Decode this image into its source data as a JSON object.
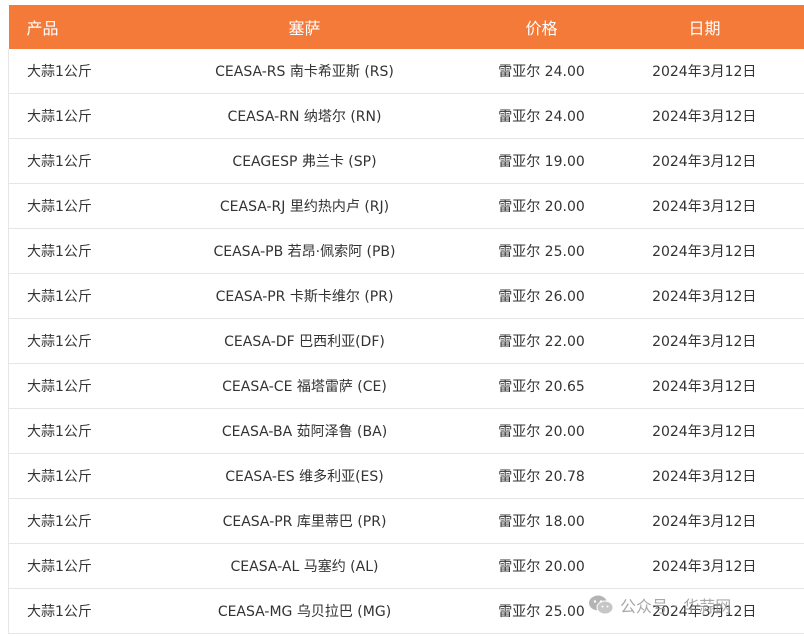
{
  "table": {
    "headers": [
      "产品",
      "塞萨",
      "价格",
      "日期"
    ],
    "rows": [
      {
        "product": "大蒜1公斤",
        "ceasa": "CEASA-RS 南卡希亚斯 (RS)",
        "price": "雷亚尔 24.00",
        "date": "2024年3月12日"
      },
      {
        "product": "大蒜1公斤",
        "ceasa": "CEASA-RN 纳塔尔 (RN)",
        "price": "雷亚尔 24.00",
        "date": "2024年3月12日"
      },
      {
        "product": "大蒜1公斤",
        "ceasa": "CEAGESP 弗兰卡 (SP)",
        "price": "雷亚尔 19.00",
        "date": "2024年3月12日"
      },
      {
        "product": "大蒜1公斤",
        "ceasa": "CEASA-RJ 里约热内卢 (RJ)",
        "price": "雷亚尔 20.00",
        "date": "2024年3月12日"
      },
      {
        "product": "大蒜1公斤",
        "ceasa": "CEASA-PB 若昂·佩索阿 (PB)",
        "price": "雷亚尔 25.00",
        "date": "2024年3月12日"
      },
      {
        "product": "大蒜1公斤",
        "ceasa": "CEASA-PR 卡斯卡维尔 (PR)",
        "price": "雷亚尔 26.00",
        "date": "2024年3月12日"
      },
      {
        "product": "大蒜1公斤",
        "ceasa": "CEASA-DF 巴西利亚(DF)",
        "price": "雷亚尔 22.00",
        "date": "2024年3月12日"
      },
      {
        "product": "大蒜1公斤",
        "ceasa": "CEASA-CE 福塔雷萨 (CE)",
        "price": "雷亚尔 20.65",
        "date": "2024年3月12日"
      },
      {
        "product": "大蒜1公斤",
        "ceasa": "CEASA-BA 茹阿泽鲁 (BA)",
        "price": "雷亚尔 20.00",
        "date": "2024年3月12日"
      },
      {
        "product": "大蒜1公斤",
        "ceasa": "CEASA-ES 维多利亚(ES)",
        "price": "雷亚尔 20.78",
        "date": "2024年3月12日"
      },
      {
        "product": "大蒜1公斤",
        "ceasa": "CEASA-PR 库里蒂巴 (PR)",
        "price": "雷亚尔 18.00",
        "date": "2024年3月12日"
      },
      {
        "product": "大蒜1公斤",
        "ceasa": "CEASA-AL 马塞约 (AL)",
        "price": "雷亚尔 20.00",
        "date": "2024年3月12日"
      },
      {
        "product": "大蒜1公斤",
        "ceasa": "CEASA-MG 乌贝拉巴 (MG)",
        "price": "雷亚尔 25.00",
        "date": "2024年3月12日"
      }
    ]
  },
  "watermark": {
    "text": "公众号 · 华蒜网",
    "icon": "wechat-icon"
  },
  "colors": {
    "header_bg": "#f47a3a",
    "header_text": "#ffffff",
    "row_border": "#e6e6e6",
    "body_text": "#333333"
  }
}
